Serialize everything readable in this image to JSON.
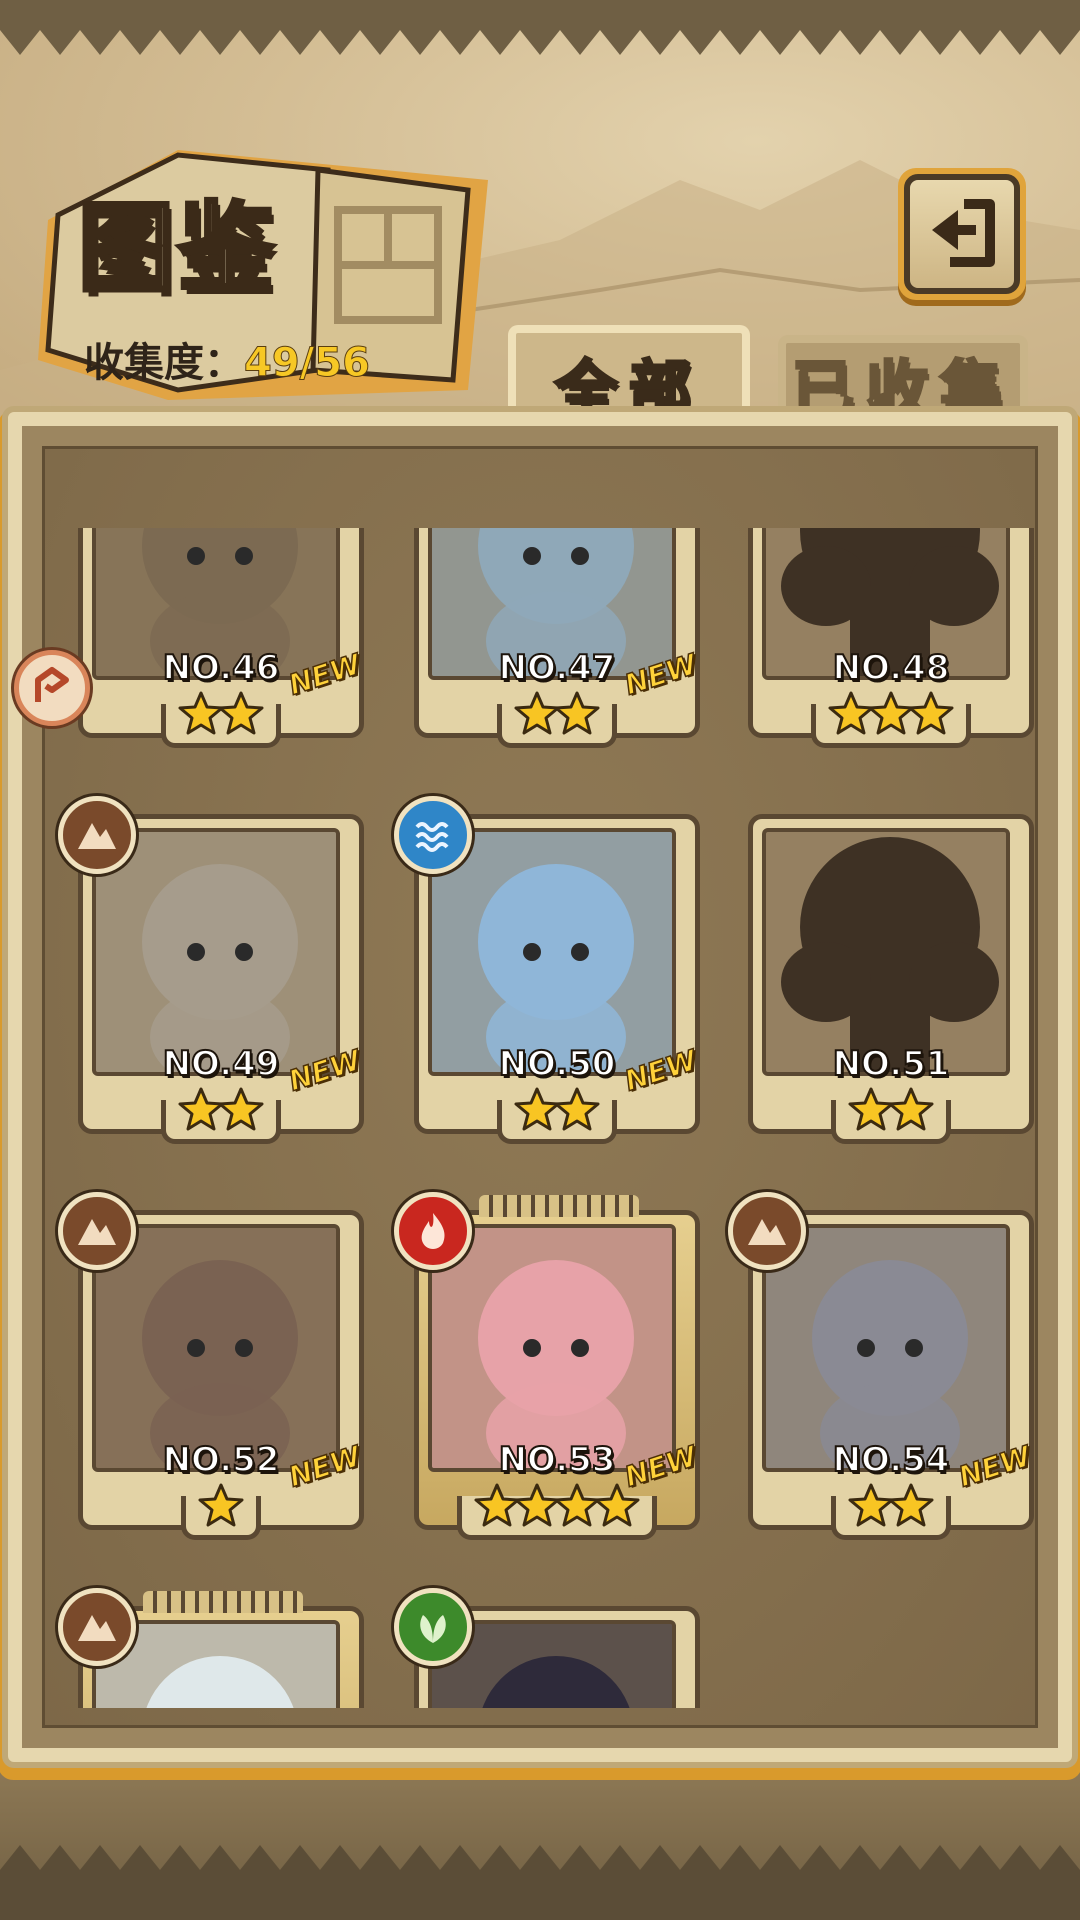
{
  "header": {
    "title": "图鉴",
    "collection_label": "收集度：",
    "collection_value": "49/56"
  },
  "tabs": [
    {
      "label": "全部",
      "active": true
    },
    {
      "label": "已收集",
      "active": false
    }
  ],
  "buttons": {
    "back_icon": "return-arrow-icon"
  },
  "colors": {
    "accent_gold": "#f7c825",
    "panel_border": "#e6d7ae",
    "earth": "#7a4a2b",
    "water": "#2f86c8",
    "fire": "#c9271f",
    "plant": "#3d8a2b"
  },
  "cards": [
    {
      "label": "NO.46",
      "stars": 2,
      "new": true,
      "element": null,
      "collected": true,
      "rare": false
    },
    {
      "label": "NO.47",
      "stars": 2,
      "new": true,
      "element": null,
      "collected": true,
      "rare": false
    },
    {
      "label": "NO.48",
      "stars": 3,
      "new": false,
      "element": null,
      "collected": false,
      "rare": false
    },
    {
      "label": "NO.49",
      "stars": 2,
      "new": true,
      "element": "earth",
      "collected": true,
      "rare": false
    },
    {
      "label": "NO.50",
      "stars": 2,
      "new": true,
      "element": "water",
      "collected": true,
      "rare": false
    },
    {
      "label": "NO.51",
      "stars": 2,
      "new": false,
      "element": null,
      "collected": false,
      "rare": false
    },
    {
      "label": "NO.52",
      "stars": 1,
      "new": true,
      "element": "earth",
      "collected": true,
      "rare": false
    },
    {
      "label": "NO.53",
      "stars": 4,
      "new": true,
      "element": "fire",
      "collected": true,
      "rare": true
    },
    {
      "label": "NO.54",
      "stars": 2,
      "new": true,
      "element": "earth",
      "collected": true,
      "rare": false
    },
    {
      "label": "",
      "stars": 0,
      "new": false,
      "element": "earth",
      "collected": true,
      "rare": true
    },
    {
      "label": "",
      "stars": 0,
      "new": false,
      "element": "plant",
      "collected": true,
      "rare": false
    }
  ],
  "new_badge_text": "NEW"
}
